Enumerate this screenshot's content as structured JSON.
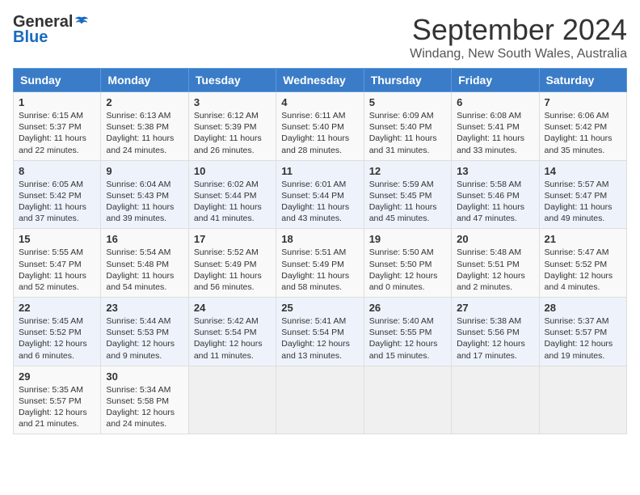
{
  "header": {
    "logo_general": "General",
    "logo_blue": "Blue",
    "title": "September 2024",
    "location": "Windang, New South Wales, Australia"
  },
  "weekdays": [
    "Sunday",
    "Monday",
    "Tuesday",
    "Wednesday",
    "Thursday",
    "Friday",
    "Saturday"
  ],
  "weeks": [
    [
      {
        "day": "1",
        "sunrise": "6:15 AM",
        "sunset": "5:37 PM",
        "daylight": "11 hours and 22 minutes."
      },
      {
        "day": "2",
        "sunrise": "6:13 AM",
        "sunset": "5:38 PM",
        "daylight": "11 hours and 24 minutes."
      },
      {
        "day": "3",
        "sunrise": "6:12 AM",
        "sunset": "5:39 PM",
        "daylight": "11 hours and 26 minutes."
      },
      {
        "day": "4",
        "sunrise": "6:11 AM",
        "sunset": "5:40 PM",
        "daylight": "11 hours and 28 minutes."
      },
      {
        "day": "5",
        "sunrise": "6:09 AM",
        "sunset": "5:40 PM",
        "daylight": "11 hours and 31 minutes."
      },
      {
        "day": "6",
        "sunrise": "6:08 AM",
        "sunset": "5:41 PM",
        "daylight": "11 hours and 33 minutes."
      },
      {
        "day": "7",
        "sunrise": "6:06 AM",
        "sunset": "5:42 PM",
        "daylight": "11 hours and 35 minutes."
      }
    ],
    [
      {
        "day": "8",
        "sunrise": "6:05 AM",
        "sunset": "5:42 PM",
        "daylight": "11 hours and 37 minutes."
      },
      {
        "day": "9",
        "sunrise": "6:04 AM",
        "sunset": "5:43 PM",
        "daylight": "11 hours and 39 minutes."
      },
      {
        "day": "10",
        "sunrise": "6:02 AM",
        "sunset": "5:44 PM",
        "daylight": "11 hours and 41 minutes."
      },
      {
        "day": "11",
        "sunrise": "6:01 AM",
        "sunset": "5:44 PM",
        "daylight": "11 hours and 43 minutes."
      },
      {
        "day": "12",
        "sunrise": "5:59 AM",
        "sunset": "5:45 PM",
        "daylight": "11 hours and 45 minutes."
      },
      {
        "day": "13",
        "sunrise": "5:58 AM",
        "sunset": "5:46 PM",
        "daylight": "11 hours and 47 minutes."
      },
      {
        "day": "14",
        "sunrise": "5:57 AM",
        "sunset": "5:47 PM",
        "daylight": "11 hours and 49 minutes."
      }
    ],
    [
      {
        "day": "15",
        "sunrise": "5:55 AM",
        "sunset": "5:47 PM",
        "daylight": "11 hours and 52 minutes."
      },
      {
        "day": "16",
        "sunrise": "5:54 AM",
        "sunset": "5:48 PM",
        "daylight": "11 hours and 54 minutes."
      },
      {
        "day": "17",
        "sunrise": "5:52 AM",
        "sunset": "5:49 PM",
        "daylight": "11 hours and 56 minutes."
      },
      {
        "day": "18",
        "sunrise": "5:51 AM",
        "sunset": "5:49 PM",
        "daylight": "11 hours and 58 minutes."
      },
      {
        "day": "19",
        "sunrise": "5:50 AM",
        "sunset": "5:50 PM",
        "daylight": "12 hours and 0 minutes."
      },
      {
        "day": "20",
        "sunrise": "5:48 AM",
        "sunset": "5:51 PM",
        "daylight": "12 hours and 2 minutes."
      },
      {
        "day": "21",
        "sunrise": "5:47 AM",
        "sunset": "5:52 PM",
        "daylight": "12 hours and 4 minutes."
      }
    ],
    [
      {
        "day": "22",
        "sunrise": "5:45 AM",
        "sunset": "5:52 PM",
        "daylight": "12 hours and 6 minutes."
      },
      {
        "day": "23",
        "sunrise": "5:44 AM",
        "sunset": "5:53 PM",
        "daylight": "12 hours and 9 minutes."
      },
      {
        "day": "24",
        "sunrise": "5:42 AM",
        "sunset": "5:54 PM",
        "daylight": "12 hours and 11 minutes."
      },
      {
        "day": "25",
        "sunrise": "5:41 AM",
        "sunset": "5:54 PM",
        "daylight": "12 hours and 13 minutes."
      },
      {
        "day": "26",
        "sunrise": "5:40 AM",
        "sunset": "5:55 PM",
        "daylight": "12 hours and 15 minutes."
      },
      {
        "day": "27",
        "sunrise": "5:38 AM",
        "sunset": "5:56 PM",
        "daylight": "12 hours and 17 minutes."
      },
      {
        "day": "28",
        "sunrise": "5:37 AM",
        "sunset": "5:57 PM",
        "daylight": "12 hours and 19 minutes."
      }
    ],
    [
      {
        "day": "29",
        "sunrise": "5:35 AM",
        "sunset": "5:57 PM",
        "daylight": "12 hours and 21 minutes."
      },
      {
        "day": "30",
        "sunrise": "5:34 AM",
        "sunset": "5:58 PM",
        "daylight": "12 hours and 24 minutes."
      },
      null,
      null,
      null,
      null,
      null
    ]
  ]
}
